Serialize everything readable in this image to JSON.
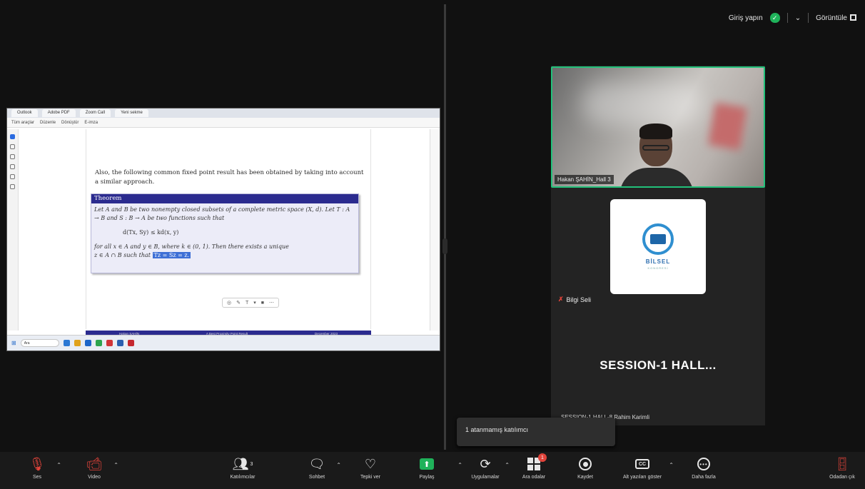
{
  "top_bar": {
    "sign_in": "Giriş yapın",
    "view": "Görüntüle"
  },
  "shared_screen": {
    "tabs": [
      "Outlook",
      "Adobe PDF",
      "Zoom Call",
      "Yeni sekme"
    ],
    "toolbar_items": [
      "Tüm araçlar",
      "Düzenle",
      "Dönüştür",
      "E-imza"
    ],
    "paragraph": "Also, the following common fixed point result has been obtained by taking into account a similar approach.",
    "theorem_title": "Theorem",
    "theorem_line1": "Let A and B be two nonempty closed subsets of a complete metric space (X, d). Let T : A → B and S : B → A be two functions such that",
    "theorem_math": "d(Tx, Sy) ≤ kd(x, y)",
    "theorem_line2": "for all x ∈ A and y ∈ B, where k ∈ (0, 1). Then there exists a unique",
    "theorem_line3_prefix": "z ∈ A ∩ B such that",
    "theorem_highlight": "Tz = Sz = z.",
    "footer_left": "Hakan ŞAHİN",
    "footer_mid": "A Best Proximity Point Result",
    "footer_right": "December 2023",
    "taskbar_search": "Ara"
  },
  "participants": {
    "video_name": "Hakan ŞAHİN_Hall 3",
    "logo_text": "BİLSEL",
    "logo_subtext": "KONGRESİ",
    "bilgi_name": "Bilgi Seli",
    "session_title": "SESSION-1  HALL...",
    "hall_tag": "SESSION-1 HALL-8 Rahim Karimli"
  },
  "popup": {
    "unassigned": "1 atanmamış katılımcı"
  },
  "toolbar": {
    "audio": "Ses",
    "video": "Video",
    "participants": "Katılımcılar",
    "participants_count": "3",
    "chat": "Sohbet",
    "react": "Tepki ver",
    "share": "Paylaş",
    "apps": "Uygulamalar",
    "breakout": "Ara odalar",
    "breakout_badge": "1",
    "record": "Kaydet",
    "captions": "Alt yazıları göster",
    "more": "Daha fazla",
    "leave": "Odadan çık"
  },
  "colors": {
    "active_speaker": "#22c17a",
    "share_green": "#1fb25a",
    "alert_red": "#e0433a",
    "beamer_blue": "#2b2b8f"
  }
}
